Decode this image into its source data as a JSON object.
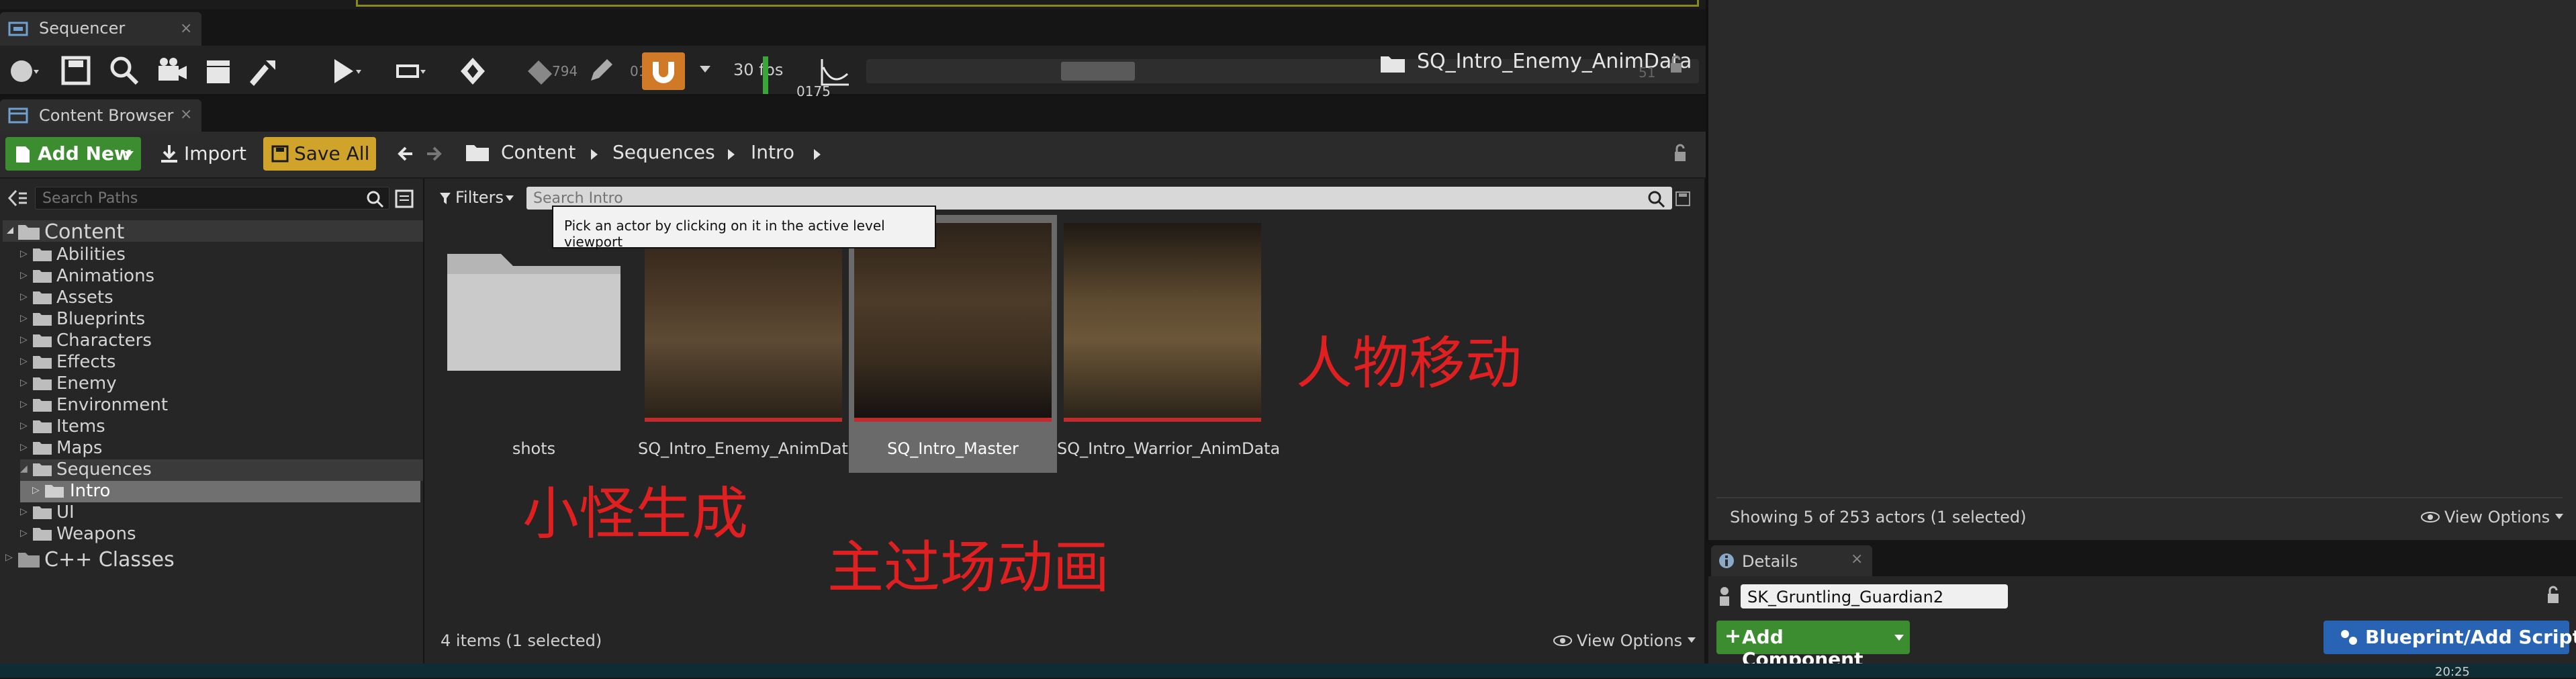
{
  "colors": {
    "accent_green": "#3c8d2f",
    "save_yellow": "#d0a42a",
    "annotation_red": "#e02020",
    "blueprint_blue": "#2863b4"
  },
  "sequencer": {
    "tab_label": "Sequencer",
    "fps_label": "30 fps",
    "frame_left": "794",
    "frame_mid": "01",
    "time_value": "0175",
    "asset_name": "SQ_Intro_Enemy_AnimData",
    "frame_right": "51"
  },
  "content_browser": {
    "tab_label": "Content Browser",
    "add_new_label": "Add New",
    "import_label": "Import",
    "save_all_label": "Save All",
    "breadcrumbs": [
      "Content",
      "Sequences",
      "Intro"
    ],
    "search_paths_placeholder": "Search Paths",
    "filters_label": "Filters",
    "search_intro_placeholder": "Search Intro",
    "tooltip": "Pick an actor by clicking on it in the active level viewport",
    "tree": {
      "root": "Content",
      "folders": [
        "Abilities",
        "Animations",
        "Assets",
        "Blueprints",
        "Characters",
        "Effects",
        "Enemy",
        "Environment",
        "Items",
        "Maps",
        "Sequences"
      ],
      "subfolder": "Intro",
      "folders_after": [
        "UI",
        "Weapons"
      ],
      "cpp_root": "C++ Classes"
    },
    "assets": [
      {
        "label": "shots"
      },
      {
        "label": "SQ_Intro_Enemy_AnimData"
      },
      {
        "label": "SQ_Intro_Master"
      },
      {
        "label": "SQ_Intro_Warrior_AnimData"
      }
    ],
    "annotations": [
      "人物移动",
      "小怪生成",
      "主过场动画"
    ],
    "status": "4 items (1 selected)",
    "view_options": "View Options"
  },
  "outliner": {
    "showing": "Showing 5 of 253 actors (1 selected)",
    "view_options": "View Options"
  },
  "details": {
    "tab_label": "Details",
    "actor_name": "SK_Gruntling_Guardian2",
    "add_component_label": "Add Component",
    "blueprint_label": "Blueprint/Add Script"
  },
  "taskbar": {
    "clock": "20:25"
  }
}
